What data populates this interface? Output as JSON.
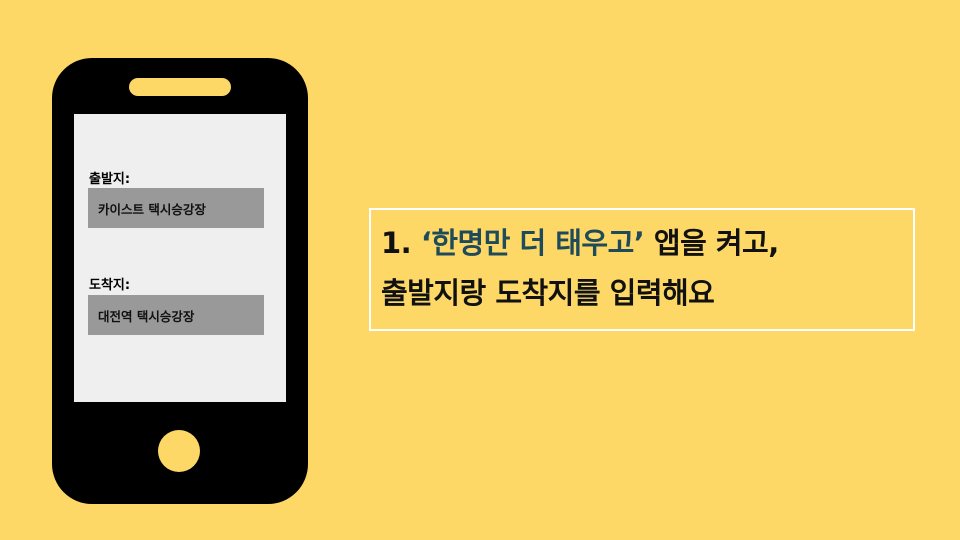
{
  "colors": {
    "background": "#FDD867",
    "phone_body": "#000000",
    "screen": "#EFEFEF",
    "field_box": "#999999",
    "highlight_text": "#1F4A5A",
    "caption_border": "#FFFFFF"
  },
  "phone": {
    "departure": {
      "label": "출발지:",
      "value": "카이스트 택시승강장"
    },
    "arrival": {
      "label": "도착지:",
      "value": "대전역 택시승강장"
    }
  },
  "caption": {
    "step_number": "1.",
    "app_name_quoted": "‘한명만 더 태우고’",
    "line1_rest": "앱을 켜고,",
    "line2": "출발지랑 도착지를 입력해요"
  }
}
